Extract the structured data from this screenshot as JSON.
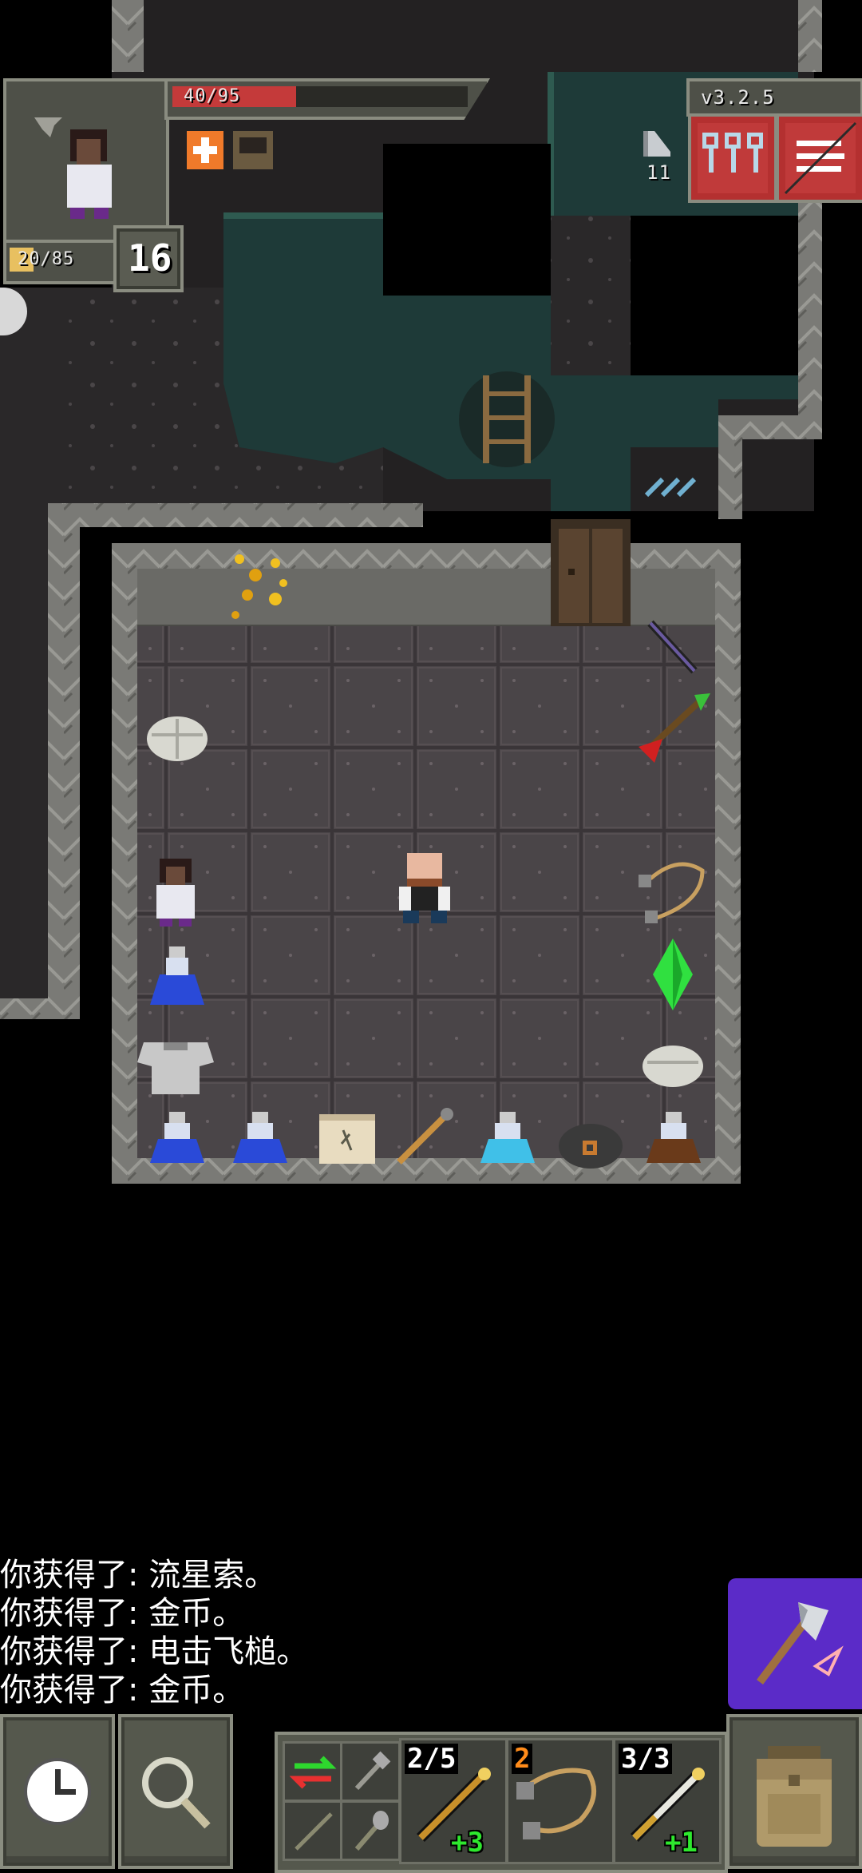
{
  "hud": {
    "hp": "40/95",
    "exp": "20/85",
    "depth": "16",
    "version": "v3.2.5",
    "keys_count": "11",
    "hp_fraction": 0.42,
    "exp_fraction": 0.24
  },
  "log": [
    "你获得了:  流星索。",
    "你获得了:  金币。",
    "你获得了:  电击飞槌。",
    "你获得了:  金币。"
  ],
  "quickslots": [
    {
      "count": "2/5",
      "count_color": "#ffffff",
      "bonus": "+3",
      "icon": "wand-icon"
    },
    {
      "count": "2",
      "count_color": "#ff8c1a",
      "bonus": "",
      "icon": "bolas-icon"
    },
    {
      "count": "3/3",
      "count_color": "#ffffff",
      "bonus": "+1",
      "icon": "staff-icon"
    }
  ],
  "colors": {
    "hp_bar": "#c43a3a",
    "exp_bar": "#e8c060",
    "buff_orange": "#f07a2a",
    "action_button": "#5b2bc8",
    "floor": "#4a4548",
    "water": "#1e3a38"
  },
  "icons": {
    "wait": "clock-icon",
    "search": "magnifier-icon",
    "backpack": "backpack-icon",
    "action": "axe-icon",
    "journal": "keys-icon",
    "menu": "menu-icon"
  }
}
